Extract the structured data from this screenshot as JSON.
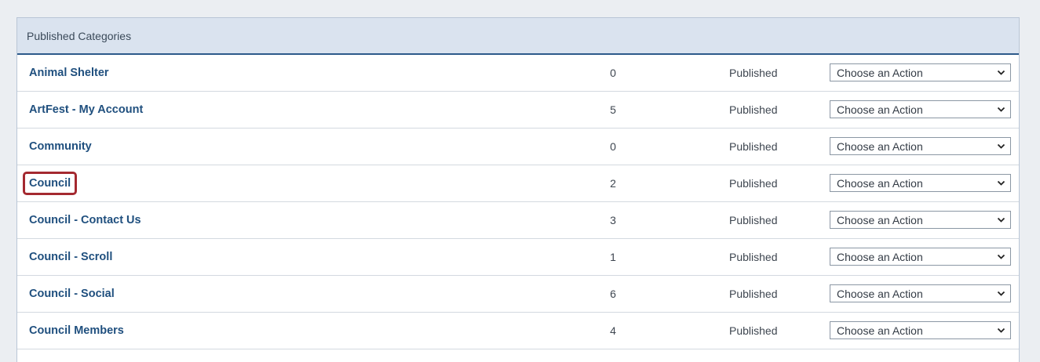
{
  "panel": {
    "title": "Published Categories"
  },
  "rows": [
    {
      "name": "Animal Shelter",
      "count": "0",
      "status": "Published",
      "action": "Choose an Action"
    },
    {
      "name": "ArtFest - My Account",
      "count": "5",
      "status": "Published",
      "action": "Choose an Action"
    },
    {
      "name": "Community",
      "count": "0",
      "status": "Published",
      "action": "Choose an Action"
    },
    {
      "name": "Council",
      "count": "2",
      "status": "Published",
      "action": "Choose an Action"
    },
    {
      "name": "Council - Contact Us",
      "count": "3",
      "status": "Published",
      "action": "Choose an Action"
    },
    {
      "name": "Council - Scroll",
      "count": "1",
      "status": "Published",
      "action": "Choose an Action"
    },
    {
      "name": "Council - Social",
      "count": "6",
      "status": "Published",
      "action": "Choose an Action"
    },
    {
      "name": "Council Members",
      "count": "4",
      "status": "Published",
      "action": "Choose an Action"
    }
  ],
  "highlighted_row": 3,
  "colors": {
    "link": "#1f4f7e",
    "header_bg": "#dae3ef",
    "header_rule": "#2d5a8a",
    "highlight": "#a42930"
  }
}
